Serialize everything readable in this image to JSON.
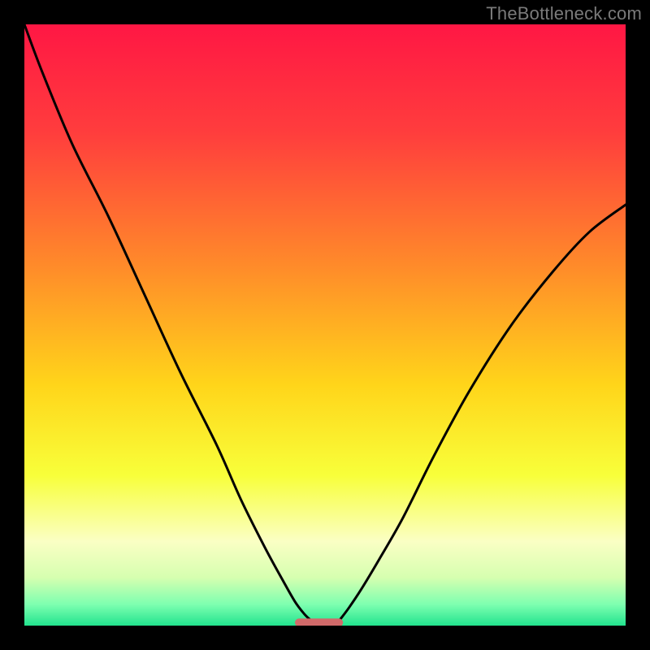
{
  "watermark": "TheBottleneck.com",
  "chart_data": {
    "type": "line",
    "title": "",
    "xlabel": "",
    "ylabel": "",
    "xlim": [
      0,
      100
    ],
    "ylim": [
      0,
      100
    ],
    "gradient_stops": [
      {
        "offset": 0.0,
        "color": "#ff1744"
      },
      {
        "offset": 0.18,
        "color": "#ff3d3d"
      },
      {
        "offset": 0.4,
        "color": "#ff8a2a"
      },
      {
        "offset": 0.6,
        "color": "#ffd51a"
      },
      {
        "offset": 0.75,
        "color": "#f8ff3a"
      },
      {
        "offset": 0.86,
        "color": "#faffc4"
      },
      {
        "offset": 0.92,
        "color": "#d6ffb0"
      },
      {
        "offset": 0.965,
        "color": "#7dffb0"
      },
      {
        "offset": 1.0,
        "color": "#22e38e"
      }
    ],
    "series": [
      {
        "name": "left-curve",
        "x": [
          0,
          3,
          8,
          14,
          20,
          26,
          32,
          36,
          40,
          43,
          45,
          46.5,
          47.5
        ],
        "y": [
          100,
          92,
          80,
          68,
          55,
          42,
          30,
          21,
          13,
          7.5,
          4,
          2,
          1
        ]
      },
      {
        "name": "right-curve",
        "x": [
          52.5,
          54,
          56,
          59,
          63,
          68,
          74,
          81,
          88,
          94,
          100
        ],
        "y": [
          1,
          3,
          6,
          11,
          18,
          28,
          39,
          50,
          59,
          65.5,
          70
        ]
      }
    ],
    "marker": {
      "x_start": 45,
      "x_end": 53,
      "y": 0.5,
      "color": "#d16a6a"
    }
  }
}
